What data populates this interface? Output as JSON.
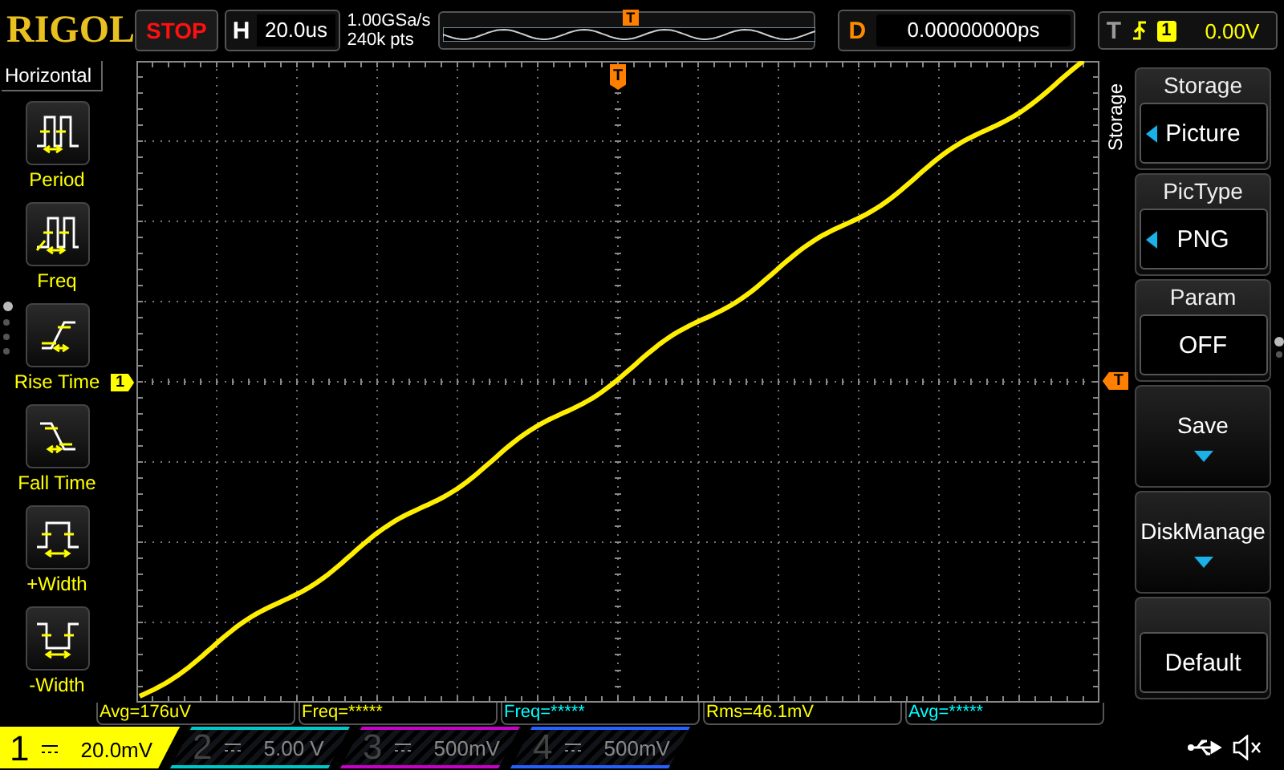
{
  "brand": "RIGOL",
  "run_state": {
    "label": "STOP",
    "kind": "stop"
  },
  "horizontal": {
    "key": "H",
    "value": "20.0us"
  },
  "sample": {
    "rate": "1.00GSa/s",
    "depth": "240k pts"
  },
  "overview": {
    "marker": "T"
  },
  "delay": {
    "key": "D",
    "value": "0.00000000ps"
  },
  "trigger": {
    "key": "T",
    "source": "1",
    "level": "0.00V"
  },
  "left_menu": {
    "title": "Horizontal",
    "items": [
      {
        "label": "Period",
        "kind": "period"
      },
      {
        "label": "Freq",
        "kind": "freq"
      },
      {
        "label": "Rise Time",
        "kind": "rise"
      },
      {
        "label": "Fall Time",
        "kind": "fall"
      },
      {
        "label": "+Width",
        "kind": "pwidth"
      },
      {
        "label": "-Width",
        "kind": "nwidth"
      }
    ],
    "pages": [
      {
        "selected": true
      },
      {
        "selected": false
      },
      {
        "selected": false
      },
      {
        "selected": false
      }
    ]
  },
  "markers": {
    "channel": "1",
    "trigger_level": "T",
    "trigger_position": "T"
  },
  "right_menu": {
    "tab": "Storage",
    "items": [
      {
        "kind": "value",
        "title": "Storage",
        "value": "Picture",
        "arrow": true
      },
      {
        "kind": "value",
        "title": "PicType",
        "value": "PNG",
        "arrow": true
      },
      {
        "kind": "value",
        "title": "Param",
        "value": "OFF",
        "arrow": false
      },
      {
        "kind": "action",
        "label": "Save"
      },
      {
        "kind": "action",
        "label": "DiskManage"
      },
      {
        "kind": "plain",
        "value": "Default"
      }
    ],
    "pages": [
      {
        "selected": true
      },
      {
        "selected": false
      }
    ]
  },
  "measurements": [
    {
      "text": "Avg=176uV",
      "color": "#ffff00"
    },
    {
      "text": "Freq=*****",
      "color": "#ffff00"
    },
    {
      "text": "Freq=*****",
      "color": "#00ffff"
    },
    {
      "text": "Rms=46.1mV",
      "color": "#ffff00"
    },
    {
      "text": "Avg=*****",
      "color": "#00ffff"
    }
  ],
  "channels": [
    {
      "number": "1",
      "scale": "20.0mV",
      "on": true,
      "color": "#ffff00"
    },
    {
      "number": "2",
      "scale": "5.00 V",
      "on": false,
      "color": "#00c8c8"
    },
    {
      "number": "3",
      "scale": "500mV",
      "on": false,
      "color": "#c800c8"
    },
    {
      "number": "4",
      "scale": "500mV",
      "on": false,
      "color": "#2860ff"
    }
  ]
}
